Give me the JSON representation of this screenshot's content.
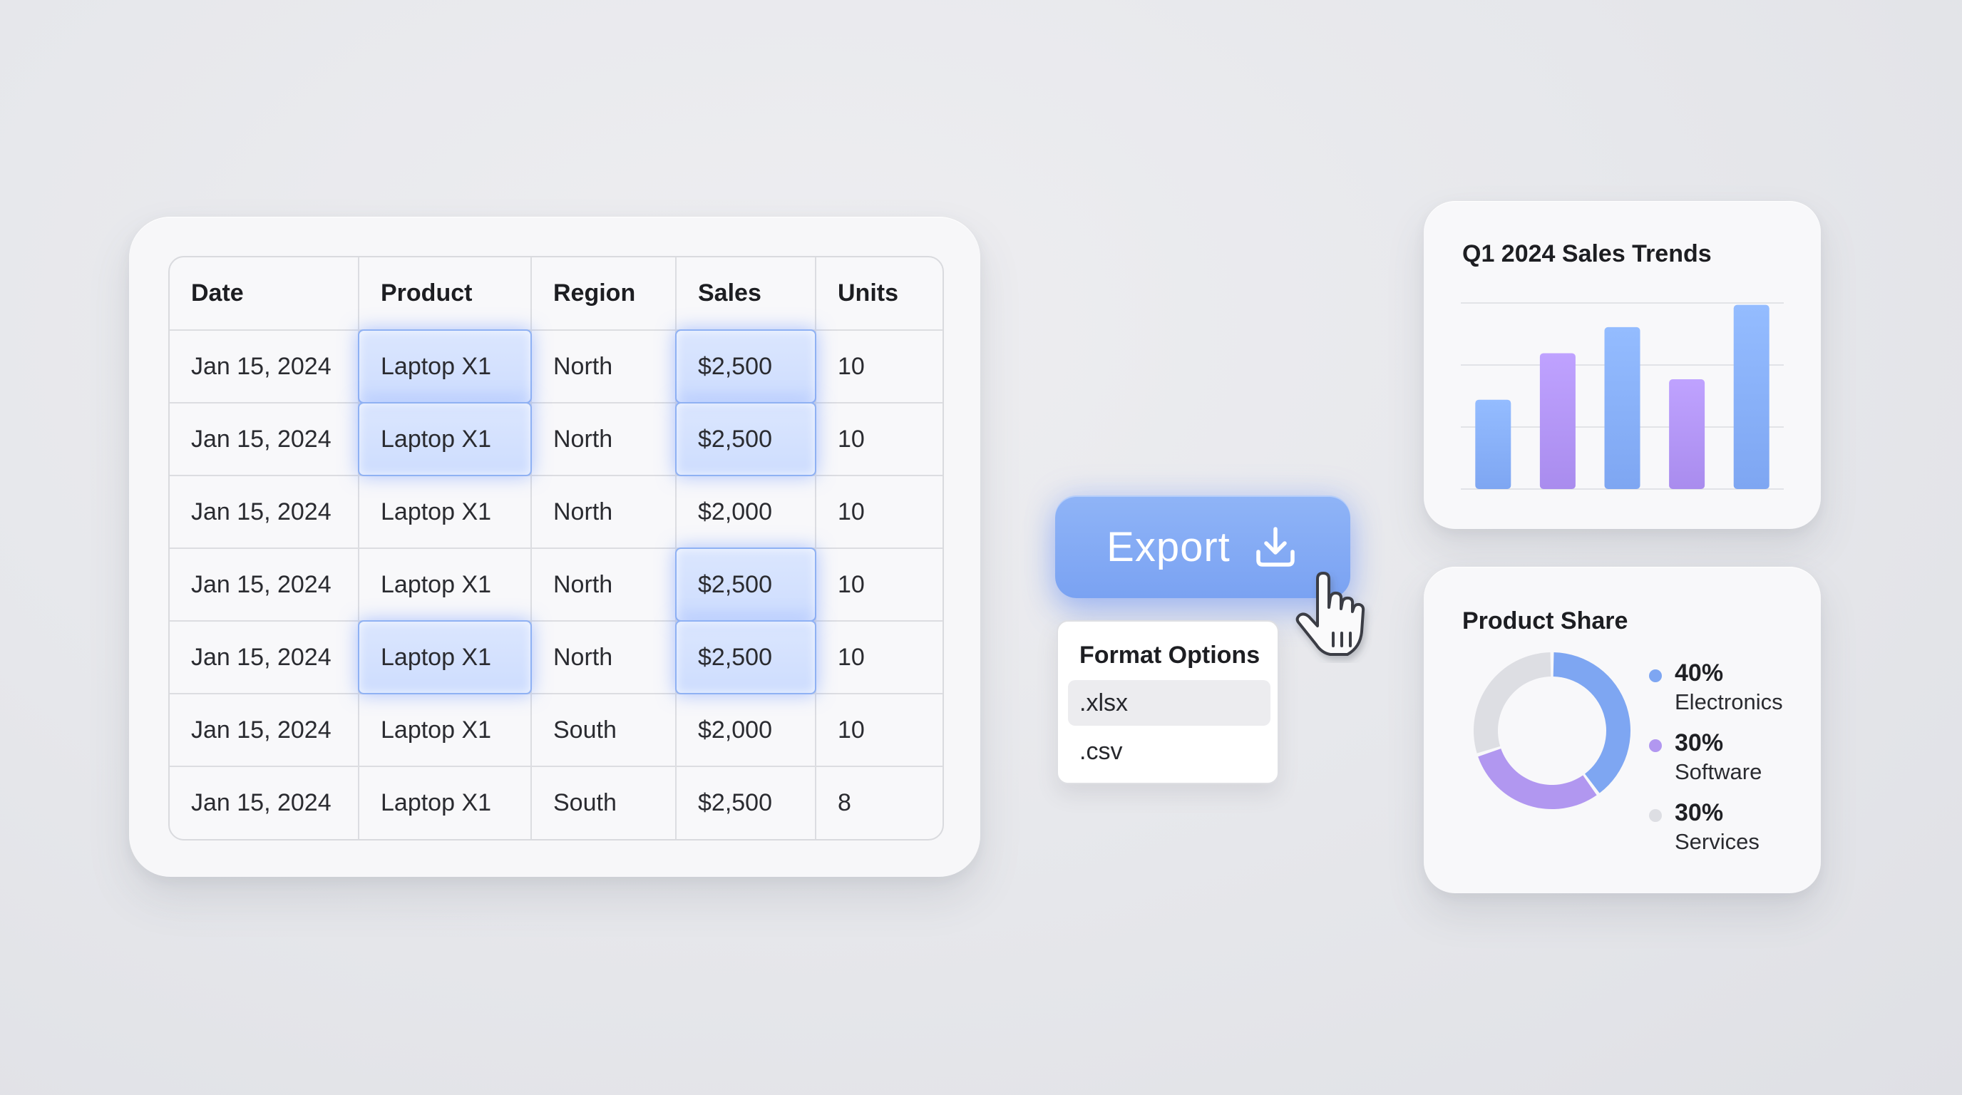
{
  "table": {
    "headers": [
      "Date",
      "Product",
      "Region",
      "Sales",
      "Units"
    ],
    "rows": [
      [
        "Jan 15, 2024",
        "Laptop X1",
        "North",
        "$2,500",
        "10"
      ],
      [
        "Jan 15, 2024",
        "Laptop X1",
        "North",
        "$2,500",
        "10"
      ],
      [
        "Jan 15, 2024",
        "Laptop X1",
        "North",
        "$2,000",
        "10"
      ],
      [
        "Jan 15, 2024",
        "Laptop X1",
        "North",
        "$2,500",
        "10"
      ],
      [
        "Jan 15, 2024",
        "Laptop X1",
        "North",
        "$2,500",
        "10"
      ],
      [
        "Jan 15, 2024",
        "Laptop X1",
        "South",
        "$2,000",
        "10"
      ],
      [
        "Jan 15, 2024",
        "Laptop X1",
        "South",
        "$2,500",
        "8"
      ]
    ],
    "highlight_color": "#8fb1f3"
  },
  "export": {
    "label": "Export",
    "icon": "download-icon",
    "color": "#7aa2f2"
  },
  "cursor": {
    "icon": "hand-pointer-icon"
  },
  "format_menu": {
    "title": "Format Options",
    "options": [
      ".xlsx",
      ".csv"
    ],
    "selected": ".xlsx"
  },
  "trends": {
    "title": "Q1 2024 Sales Trends"
  },
  "share": {
    "title": "Product Share"
  },
  "chart_data": [
    {
      "type": "bar",
      "title": "Q1 2024 Sales Trends",
      "categories": [
        "",
        "",
        "",
        "",
        ""
      ],
      "values": [
        48,
        73,
        87,
        59,
        99
      ],
      "ylim": [
        0,
        100
      ],
      "grid": true,
      "colors": [
        "#7ea6f2",
        "#a98cee",
        "#7ea6f2",
        "#a98cee",
        "#7ea6f2"
      ]
    },
    {
      "type": "pie",
      "title": "Product Share",
      "donut": true,
      "slices": [
        {
          "label": "Electronics",
          "value": 40,
          "pct_label": "40%",
          "color": "#7ea6f2"
        },
        {
          "label": "Software",
          "value": 30,
          "pct_label": "30%",
          "color": "#b197f0"
        },
        {
          "label": "Services",
          "value": 30,
          "pct_label": "30%",
          "color": "#dddee3"
        }
      ],
      "legend_placement": "right"
    }
  ]
}
